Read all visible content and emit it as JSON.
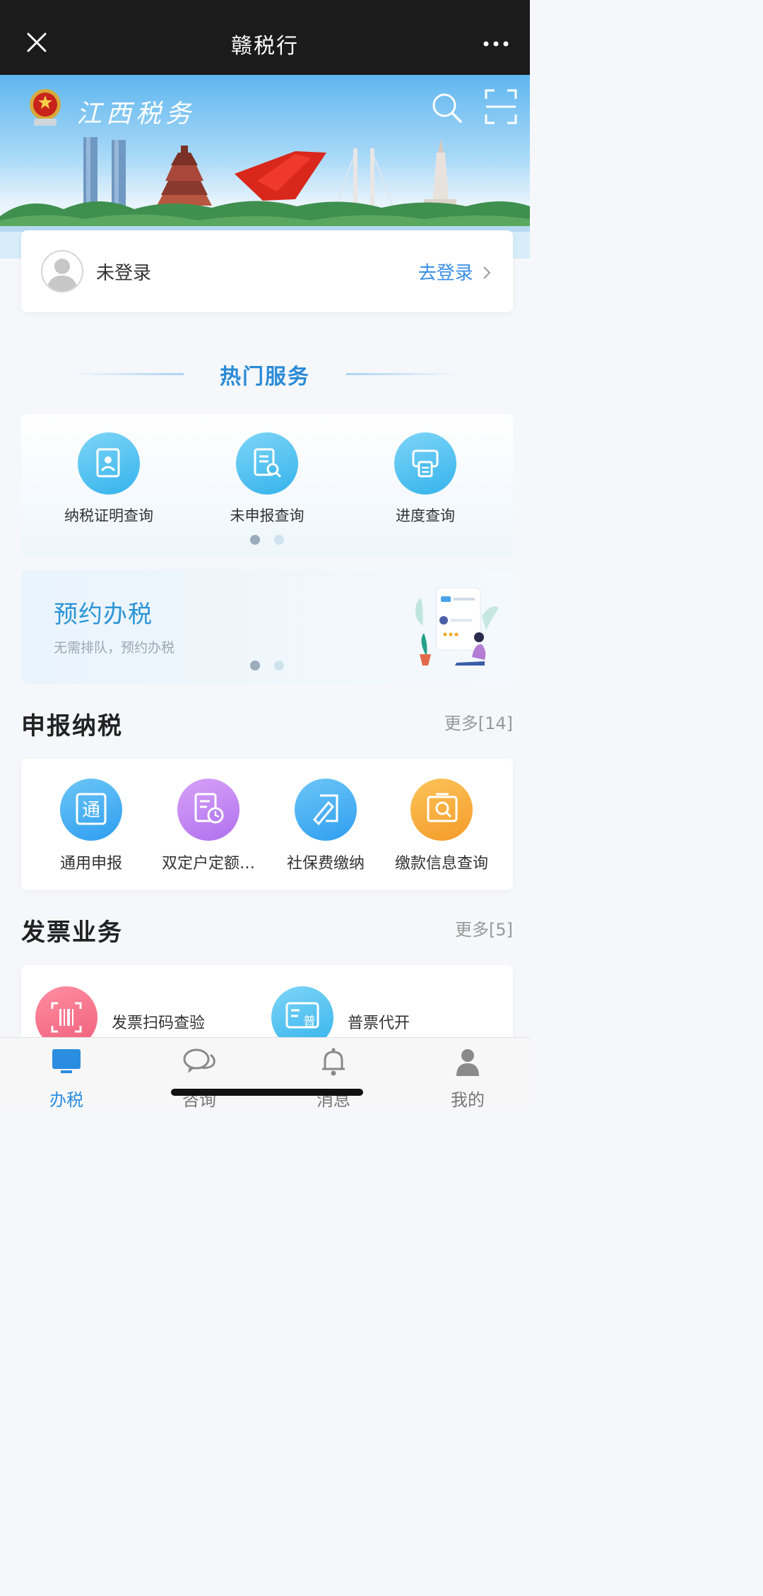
{
  "topbar": {
    "title": "赣税行",
    "close_icon": "close-icon",
    "more_icon": "more-icon"
  },
  "hero": {
    "logo_text": "江西税务",
    "search_icon": "search-icon",
    "scan_icon": "scan-icon"
  },
  "login": {
    "status": "未登录",
    "login_link": "去登录"
  },
  "hot": {
    "title": "热门服务",
    "items": [
      {
        "label": "纳税证明查询",
        "icon": "certificate-icon"
      },
      {
        "label": "未申报查询",
        "icon": "document-search-icon"
      },
      {
        "label": "进度查询",
        "icon": "printer-icon"
      }
    ],
    "pages": 2,
    "current_page": 1
  },
  "booking": {
    "title": "预约办税",
    "subtitle": "无需排队，预约办税",
    "pages": 2,
    "current_page": 1
  },
  "declaration": {
    "title": "申报纳税",
    "more": "更多[14]",
    "items": [
      {
        "label": "通用申报",
        "icon": "tong-icon",
        "color": "#3aaaf0"
      },
      {
        "label": "双定户定额…",
        "icon": "calendar-doc-icon",
        "color": "#c07ff0"
      },
      {
        "label": "社保费缴纳",
        "icon": "pen-paper-icon",
        "color": "#3aa0ee"
      },
      {
        "label": "缴款信息查询",
        "icon": "receipt-search-icon",
        "color": "#f6a636"
      }
    ]
  },
  "invoice": {
    "title": "发票业务",
    "more": "更多[5]",
    "items": [
      {
        "label": "发票扫码查验",
        "icon": "barcode-scan-icon",
        "color": "#f06a82"
      },
      {
        "label": "普票代开",
        "icon": "invoice-icon",
        "color": "#45b8ef"
      }
    ]
  },
  "bottom_nav": [
    {
      "label": "办税",
      "icon": "monitor-icon",
      "active": true
    },
    {
      "label": "咨询",
      "icon": "chat-icon",
      "active": false
    },
    {
      "label": "消息",
      "icon": "bell-icon",
      "active": false
    },
    {
      "label": "我的",
      "icon": "person-icon",
      "active": false
    }
  ]
}
